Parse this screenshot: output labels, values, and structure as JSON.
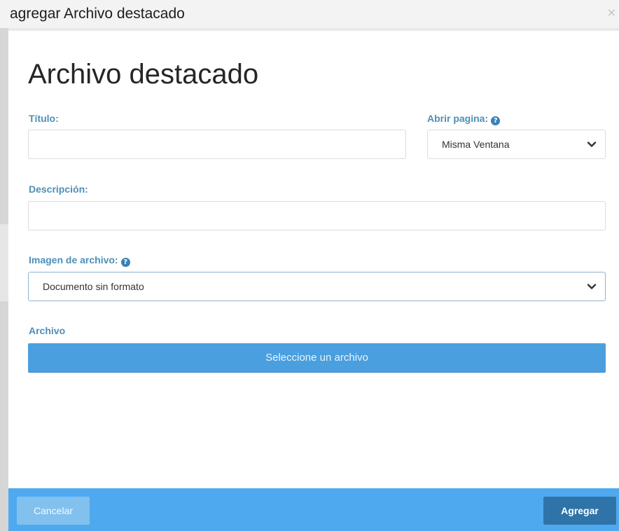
{
  "window": {
    "title": "agregar Archivo destacado",
    "close_glyph": "×"
  },
  "dialog": {
    "heading": "Archivo destacado",
    "fields": {
      "titulo": {
        "label": "Título:",
        "value": ""
      },
      "abrir_pagina": {
        "label": "Abrir pagina:",
        "help_icon": "question-circle-icon",
        "selected": "Misma Ventana"
      },
      "descripcion": {
        "label": "Descripción:",
        "value": ""
      },
      "imagen_archivo": {
        "label": "Imagen de archivo:",
        "help_icon": "question-circle-icon",
        "selected": "Documento sin formato"
      },
      "archivo": {
        "label": "Archivo",
        "button_label": "Seleccione un archivo"
      }
    },
    "footer": {
      "cancel_label": "Cancelar",
      "submit_label": "Agregar"
    }
  },
  "colors": {
    "accent_label": "#4d8fb8",
    "file_button": "#4a9fde",
    "footer_bar": "#4fa9ee",
    "cancel_button": "#82c1ee",
    "submit_button": "#2f74a8"
  }
}
